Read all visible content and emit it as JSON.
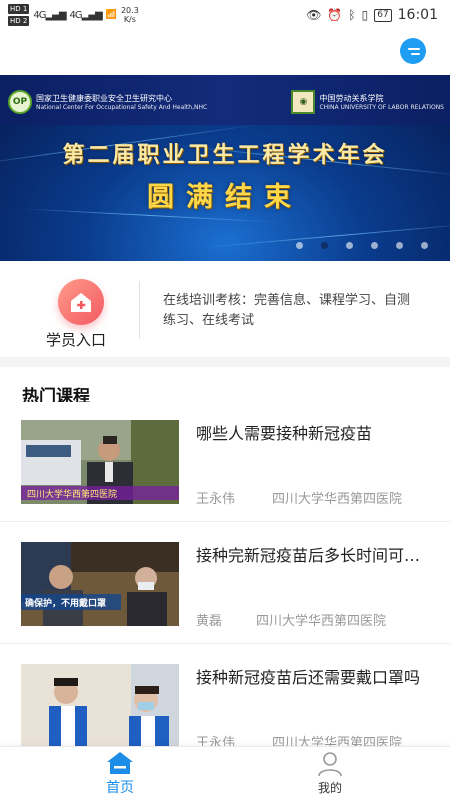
{
  "status_bar": {
    "hd1": "HD 1",
    "hd2": "HD 2",
    "net1": "4G",
    "net2": "4G",
    "speed_value": "20.3",
    "speed_unit": "K/s",
    "battery": "67",
    "time": "16:01"
  },
  "header": {
    "message_icon": "message-icon",
    "accent": "#1e9df2"
  },
  "banner": {
    "org_left_cn": "国家卫生健康委职业安全卫生研究中心",
    "org_left_en": "National Center For Occupational Safety And Health,NHC",
    "org_left_logo": "OP",
    "org_right_cn": "中国劳动关系学院",
    "org_right_en": "CHINA UNIVERSITY OF LABOR RELATIONS",
    "title": "第二届职业卫生工程学术年会",
    "subtitle": "圆满结束",
    "slides": 6,
    "active_slide": 2
  },
  "entry": {
    "label": "学员入口",
    "description": "在线培训考核：完善信息、课程学习、自测练习、在线考试",
    "icon": "home-plus-icon",
    "color": "#f25a62"
  },
  "courses_section": {
    "title": "热门课程",
    "items": [
      {
        "title": "哪些人需要接种新冠疫苗",
        "teacher": "王永伟",
        "hospital": "四川大学华西第四医院",
        "thumb_caption": "四川大学华西第四医院"
      },
      {
        "title": "接种完新冠疫苗后多长时间可以不戴口罩",
        "teacher": "黄磊",
        "hospital": "四川大学华西第四医院",
        "thumb_caption": "确保护，不用戴口罩"
      },
      {
        "title": "接种新冠疫苗后还需要戴口罩吗",
        "teacher": "王永伟",
        "hospital": "四川大学华西第四医院",
        "thumb_caption": ""
      }
    ]
  },
  "bottom_nav": {
    "home_label": "首页",
    "mine_label": "我的",
    "active_color": "#1e8de8"
  }
}
